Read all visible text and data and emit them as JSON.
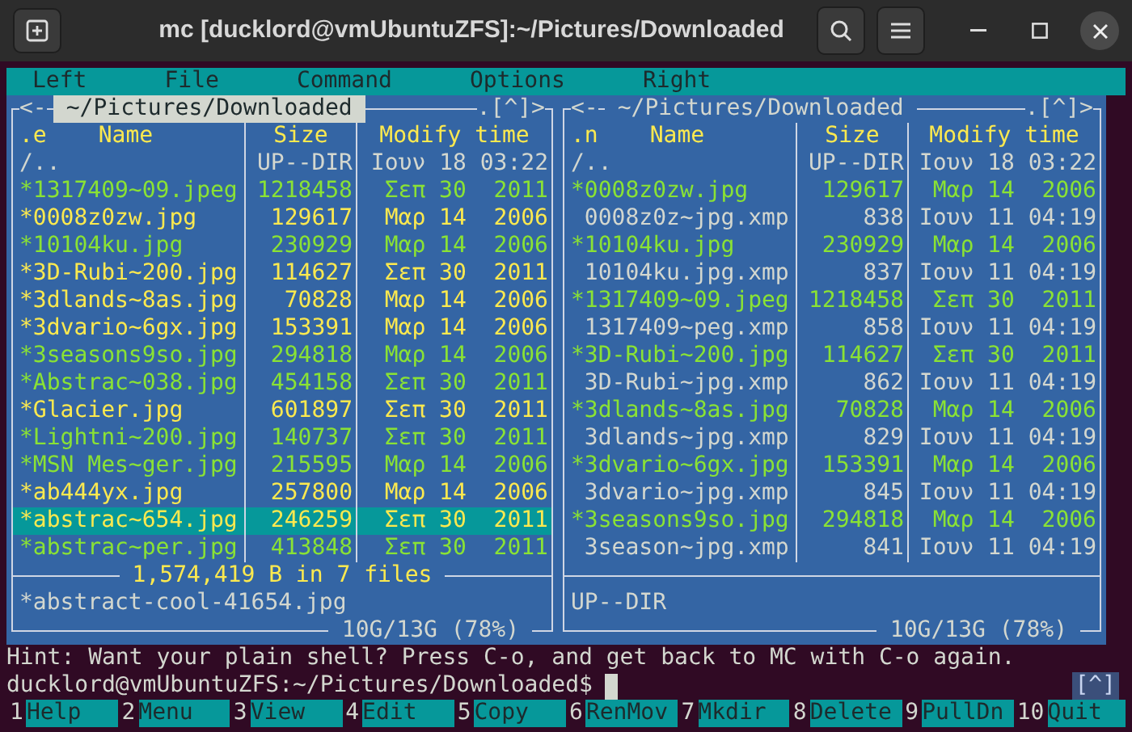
{
  "window": {
    "title": "mc [ducklord@vmUbuntuZFS]:~/Pictures/Downloaded"
  },
  "menu": [
    {
      "label": "Left"
    },
    {
      "label": "File"
    },
    {
      "label": "Command"
    },
    {
      "label": "Options"
    },
    {
      "label": "Right"
    }
  ],
  "panels": [
    {
      "active": true,
      "left_marker": "<-",
      "path": "~/Pictures/Downloaded",
      "right_marker": ".[^]>",
      "sort_mark": ".e",
      "columns": [
        "Name",
        "Size",
        "Modify time"
      ],
      "rows": [
        {
          "name": "/..",
          "size": "UP--DIR",
          "time": "Ιουν 18 03:22",
          "executable": false,
          "tagged": false,
          "selected": false
        },
        {
          "name": "*1317409~09.jpeg",
          "size": "1218458",
          "time": "Σεπ 30  2011",
          "executable": true,
          "tagged": false,
          "selected": false
        },
        {
          "name": "*0008z0zw.jpg",
          "size": "129617",
          "time": "Μαρ 14  2006",
          "executable": true,
          "tagged": true,
          "selected": false
        },
        {
          "name": "*10104ku.jpg",
          "size": "230929",
          "time": "Μαρ 14  2006",
          "executable": true,
          "tagged": false,
          "selected": false
        },
        {
          "name": "*3D-Rubi~200.jpg",
          "size": "114627",
          "time": "Σεπ 30  2011",
          "executable": true,
          "tagged": true,
          "selected": false
        },
        {
          "name": "*3dlands~8as.jpg",
          "size": "70828",
          "time": "Μαρ 14  2006",
          "executable": true,
          "tagged": true,
          "selected": false
        },
        {
          "name": "*3dvario~6gx.jpg",
          "size": "153391",
          "time": "Μαρ 14  2006",
          "executable": true,
          "tagged": true,
          "selected": false
        },
        {
          "name": "*3seasons9so.jpg",
          "size": "294818",
          "time": "Μαρ 14  2006",
          "executable": true,
          "tagged": false,
          "selected": false
        },
        {
          "name": "*Abstrac~038.jpg",
          "size": "454158",
          "time": "Σεπ 30  2011",
          "executable": true,
          "tagged": false,
          "selected": false
        },
        {
          "name": "*Glacier.jpg",
          "size": "601897",
          "time": "Σεπ 30  2011",
          "executable": true,
          "tagged": true,
          "selected": false
        },
        {
          "name": "*Lightni~200.jpg",
          "size": "140737",
          "time": "Σεπ 30  2011",
          "executable": true,
          "tagged": false,
          "selected": false
        },
        {
          "name": "*MSN Mes~ger.jpg",
          "size": "215595",
          "time": "Μαρ 14  2006",
          "executable": true,
          "tagged": false,
          "selected": false
        },
        {
          "name": "*ab444yx.jpg",
          "size": "257800",
          "time": "Μαρ 14  2006",
          "executable": true,
          "tagged": true,
          "selected": false
        },
        {
          "name": "*abstrac~654.jpg",
          "size": "246259",
          "time": "Σεπ 30  2011",
          "executable": true,
          "tagged": true,
          "selected": true
        },
        {
          "name": "*abstrac~per.jpg",
          "size": "413848",
          "time": "Σεπ 30  2011",
          "executable": true,
          "tagged": false,
          "selected": false
        }
      ],
      "totals": "1,574,419 B in 7 files",
      "mini_status": "*abstract-cool-41654.jpg",
      "disk": "10G/13G (78%)"
    },
    {
      "active": false,
      "left_marker": "<-",
      "path": "~/Pictures/Downloaded",
      "right_marker": ".[^]>",
      "sort_mark": ".n",
      "columns": [
        "Name",
        "Size",
        "Modify time"
      ],
      "rows": [
        {
          "name": "/..",
          "size": "UP--DIR",
          "time": "Ιουν 18 03:22",
          "executable": false,
          "tagged": false,
          "selected": false
        },
        {
          "name": "*0008z0zw.jpg",
          "size": "129617",
          "time": "Μαρ 14  2006",
          "executable": true,
          "tagged": false,
          "selected": false
        },
        {
          "name": " 0008z0z~jpg.xmp",
          "size": "838",
          "time": "Ιουν 11 04:19",
          "executable": false,
          "tagged": false,
          "selected": false
        },
        {
          "name": "*10104ku.jpg",
          "size": "230929",
          "time": "Μαρ 14  2006",
          "executable": true,
          "tagged": false,
          "selected": false
        },
        {
          "name": " 10104ku.jpg.xmp",
          "size": "837",
          "time": "Ιουν 11 04:19",
          "executable": false,
          "tagged": false,
          "selected": false
        },
        {
          "name": "*1317409~09.jpeg",
          "size": "1218458",
          "time": "Σεπ 30  2011",
          "executable": true,
          "tagged": false,
          "selected": false
        },
        {
          "name": " 1317409~peg.xmp",
          "size": "858",
          "time": "Ιουν 11 04:19",
          "executable": false,
          "tagged": false,
          "selected": false
        },
        {
          "name": "*3D-Rubi~200.jpg",
          "size": "114627",
          "time": "Σεπ 30  2011",
          "executable": true,
          "tagged": false,
          "selected": false
        },
        {
          "name": " 3D-Rubi~jpg.xmp",
          "size": "862",
          "time": "Ιουν 11 04:19",
          "executable": false,
          "tagged": false,
          "selected": false
        },
        {
          "name": "*3dlands~8as.jpg",
          "size": "70828",
          "time": "Μαρ 14  2006",
          "executable": true,
          "tagged": false,
          "selected": false
        },
        {
          "name": " 3dlands~jpg.xmp",
          "size": "829",
          "time": "Ιουν 11 04:19",
          "executable": false,
          "tagged": false,
          "selected": false
        },
        {
          "name": "*3dvario~6gx.jpg",
          "size": "153391",
          "time": "Μαρ 14  2006",
          "executable": true,
          "tagged": false,
          "selected": false
        },
        {
          "name": " 3dvario~jpg.xmp",
          "size": "845",
          "time": "Ιουν 11 04:19",
          "executable": false,
          "tagged": false,
          "selected": false
        },
        {
          "name": "*3seasons9so.jpg",
          "size": "294818",
          "time": "Μαρ 14  2006",
          "executable": true,
          "tagged": false,
          "selected": false
        },
        {
          "name": " 3season~jpg.xmp",
          "size": "841",
          "time": "Ιουν 11 04:19",
          "executable": false,
          "tagged": false,
          "selected": false
        }
      ],
      "mini_status": "UP--DIR",
      "disk": "10G/13G (78%)"
    }
  ],
  "hint": "Hint: Want your plain shell? Press C-o, and get back to MC with C-o again.",
  "prompt": "ducklord@vmUbuntuZFS:~/Pictures/Downloaded$",
  "shell_toggle": "[^]",
  "function_keys": [
    {
      "number": "1",
      "label": "Help"
    },
    {
      "number": "2",
      "label": "Menu"
    },
    {
      "number": "3",
      "label": "View"
    },
    {
      "number": "4",
      "label": "Edit"
    },
    {
      "number": "5",
      "label": "Copy"
    },
    {
      "number": "6",
      "label": "RenMov"
    },
    {
      "number": "7",
      "label": "Mkdir"
    },
    {
      "number": "8",
      "label": "Delete"
    },
    {
      "number": "9",
      "label": "PullDn"
    },
    {
      "number": "10",
      "label": "Quit"
    }
  ]
}
